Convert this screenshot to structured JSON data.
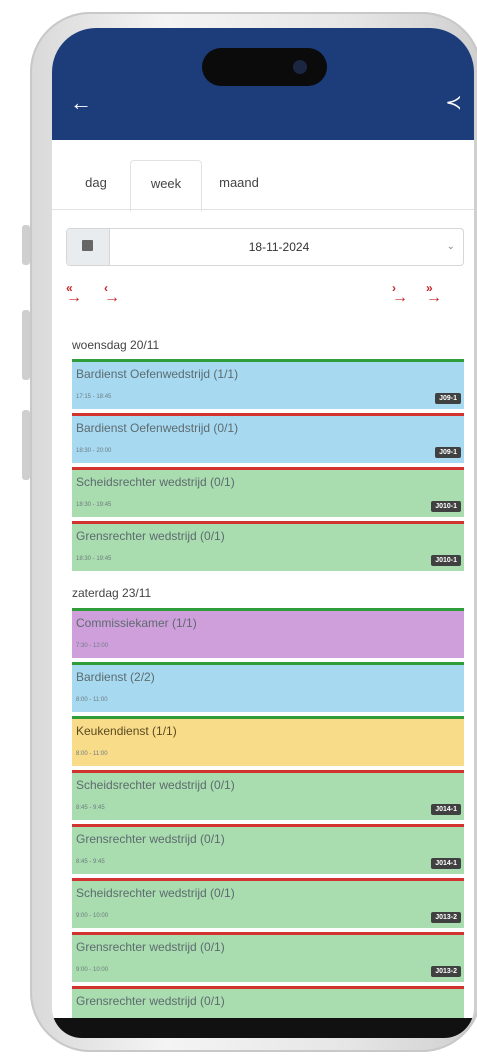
{
  "header": {
    "back_icon": "arrow-left-icon",
    "share_icon": "share-icon"
  },
  "tabs": [
    {
      "label": "dag"
    },
    {
      "label": "week"
    },
    {
      "label": "maand"
    }
  ],
  "date_picker": {
    "value": "18-11-2024",
    "calendar_icon": "calendar-icon"
  },
  "nav": {
    "first": "«",
    "prev": "‹",
    "next": "›",
    "last": "»"
  },
  "days": [
    {
      "label": "woensdag 20/11",
      "events": [
        {
          "title": "Bardienst Oefenwedstrijd (1/1)",
          "time": "17:15 - 18:45",
          "badge": "J09-1",
          "color": "blue",
          "status": "green"
        },
        {
          "title": "Bardienst Oefenwedstrijd (0/1)",
          "time": "18:30 - 20:00",
          "badge": "J09-1",
          "color": "blue",
          "status": "red"
        },
        {
          "title": "Scheidsrechter wedstrijd (0/1)",
          "time": "18:30 - 19:45",
          "badge": "J010-1",
          "color": "green",
          "status": "red"
        },
        {
          "title": "Grensrechter wedstrijd (0/1)",
          "time": "18:30 - 19:45",
          "badge": "J010-1",
          "color": "green",
          "status": "red"
        }
      ]
    },
    {
      "label": "zaterdag 23/11",
      "events": [
        {
          "title": "Commissiekamer (1/1)",
          "time": "7:30 - 12:00",
          "badge": "",
          "color": "purple",
          "status": "green"
        },
        {
          "title": "Bardienst (2/2)",
          "time": "8:00 - 11:00",
          "badge": "",
          "color": "blue",
          "status": "green"
        },
        {
          "title": "Keukendienst (1/1)",
          "time": "8:00 - 11:00",
          "badge": "",
          "color": "yellow",
          "status": "green"
        },
        {
          "title": "Scheidsrechter wedstrijd (0/1)",
          "time": "8:45 - 9:45",
          "badge": "J014-1",
          "color": "green",
          "status": "red"
        },
        {
          "title": "Grensrechter wedstrijd (0/1)",
          "time": "8:45 - 9:45",
          "badge": "J014-1",
          "color": "green",
          "status": "red"
        },
        {
          "title": "Scheidsrechter wedstrijd (0/1)",
          "time": "9:00 - 10:00",
          "badge": "J013-2",
          "color": "green",
          "status": "red"
        },
        {
          "title": "Grensrechter wedstrijd (0/1)",
          "time": "9:00 - 10:00",
          "badge": "J013-2",
          "color": "green",
          "status": "red"
        },
        {
          "title": "Grensrechter wedstrijd (0/1)",
          "time": "",
          "badge": "",
          "color": "green",
          "status": "red"
        }
      ]
    }
  ],
  "colors": {
    "header": "#1c3c7a",
    "accent_red": "#c7262a",
    "status_green": "#2e9d3a",
    "status_red": "#d2332e"
  }
}
